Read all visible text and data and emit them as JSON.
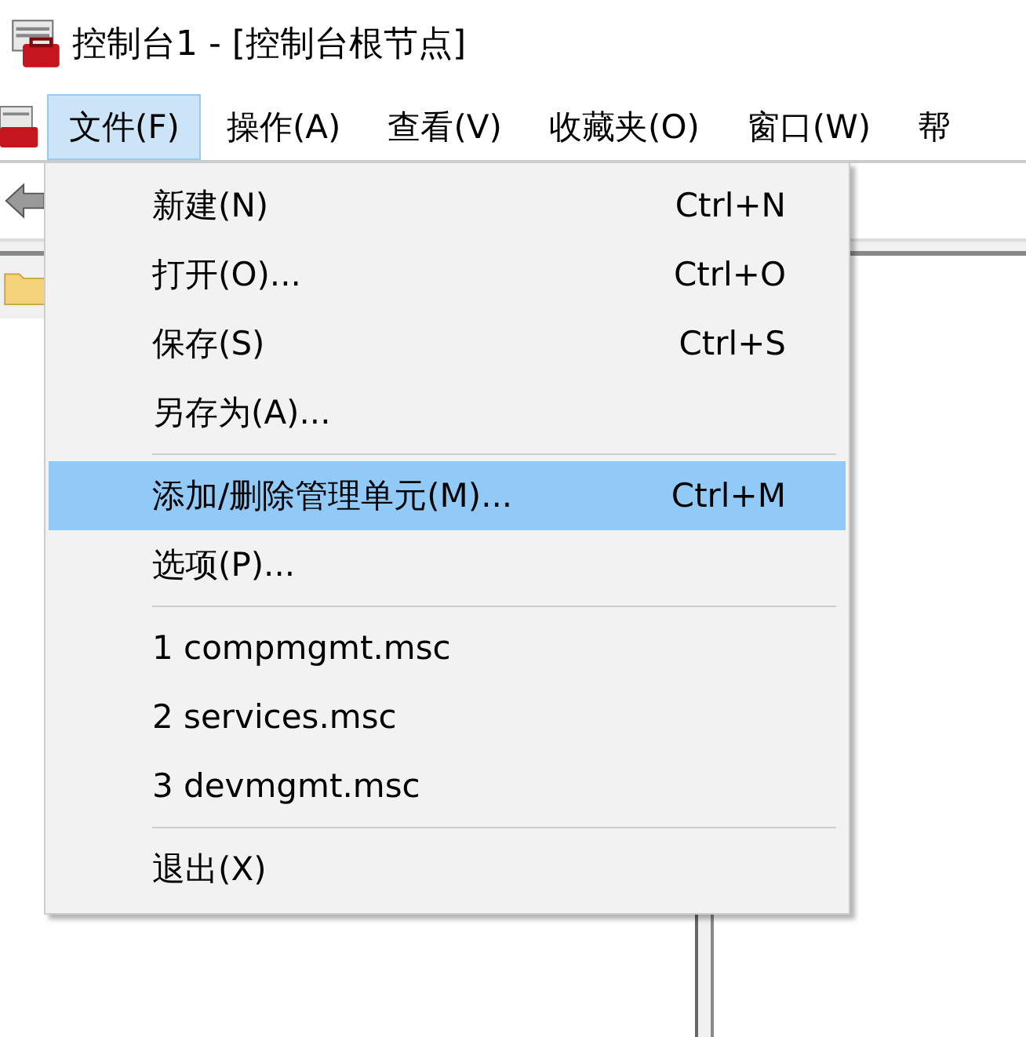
{
  "window": {
    "title": "控制台1 - [控制台根节点]"
  },
  "menu_bar": [
    {
      "label": "文件(F)",
      "selected": true
    },
    {
      "label": "操作(A)",
      "selected": false
    },
    {
      "label": "查看(V)",
      "selected": false
    },
    {
      "label": "收藏夹(O)",
      "selected": false
    },
    {
      "label": "窗口(W)",
      "selected": false
    },
    {
      "label": "帮",
      "selected": false
    }
  ],
  "file_menu": [
    {
      "kind": "item",
      "label": "新建(N)",
      "shortcut": "Ctrl+N",
      "selected": false
    },
    {
      "kind": "item",
      "label": "打开(O)...",
      "shortcut": "Ctrl+O",
      "selected": false
    },
    {
      "kind": "item",
      "label": "保存(S)",
      "shortcut": "Ctrl+S",
      "selected": false
    },
    {
      "kind": "item",
      "label": "另存为(A)...",
      "selected": false
    },
    {
      "kind": "separator"
    },
    {
      "kind": "item",
      "label": "添加/删除管理单元(M)...",
      "shortcut": "Ctrl+M",
      "selected": true
    },
    {
      "kind": "item",
      "label": "选项(P)...",
      "selected": false
    },
    {
      "kind": "separator"
    },
    {
      "kind": "item",
      "label": "1 compmgmt.msc",
      "selected": false
    },
    {
      "kind": "item",
      "label": "2 services.msc",
      "selected": false
    },
    {
      "kind": "item",
      "label": "3 devmgmt.msc",
      "selected": false
    },
    {
      "kind": "separator"
    },
    {
      "kind": "item",
      "label": "退出(X)",
      "selected": false
    }
  ]
}
